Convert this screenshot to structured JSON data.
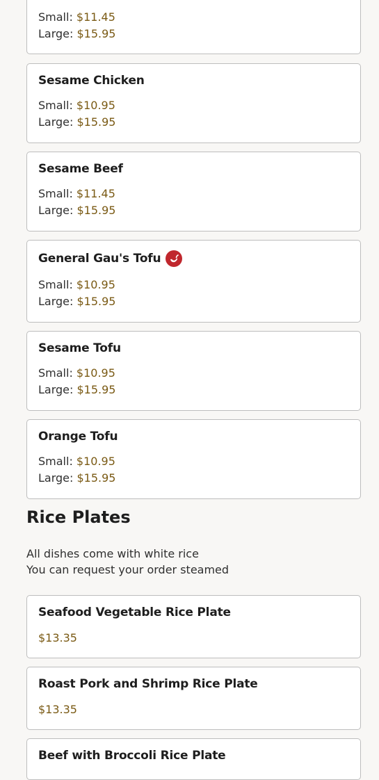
{
  "section_above": {
    "partial_card": {
      "small_label": "Small: ",
      "small_price": "$11.45",
      "large_label": "Large: ",
      "large_price": "$15.95"
    },
    "items": [
      {
        "name": "Sesame Chicken",
        "small_label": "Small: ",
        "small_price": "$10.95",
        "large_label": "Large: ",
        "large_price": "$15.95"
      },
      {
        "name": "Sesame Beef",
        "small_label": "Small: ",
        "small_price": "$11.45",
        "large_label": "Large: ",
        "large_price": "$15.95"
      },
      {
        "name": "General Gau's Tofu",
        "spicy": true,
        "spicy_icon": "chili-pepper-icon",
        "small_label": "Small: ",
        "small_price": "$10.95",
        "large_label": "Large: ",
        "large_price": "$15.95"
      },
      {
        "name": "Sesame Tofu",
        "small_label": "Small: ",
        "small_price": "$10.95",
        "large_label": "Large: ",
        "large_price": "$15.95"
      },
      {
        "name": "Orange Tofu",
        "small_label": "Small: ",
        "small_price": "$10.95",
        "large_label": "Large: ",
        "large_price": "$15.95"
      }
    ]
  },
  "rice_plates": {
    "title": "Rice Plates",
    "note_1": "All dishes come with white rice",
    "note_2": "You can request your order steamed",
    "items": [
      {
        "name": "Seafood Vegetable Rice Plate",
        "price": "$13.35"
      },
      {
        "name": "Roast Pork and Shrimp Rice Plate",
        "price": "$13.35"
      },
      {
        "name": "Beef with Broccoli Rice Plate",
        "price": ""
      }
    ]
  },
  "colors": {
    "background": "#f8f7f5",
    "price": "#7a5a14",
    "spicy_badge": "#c0272d"
  }
}
